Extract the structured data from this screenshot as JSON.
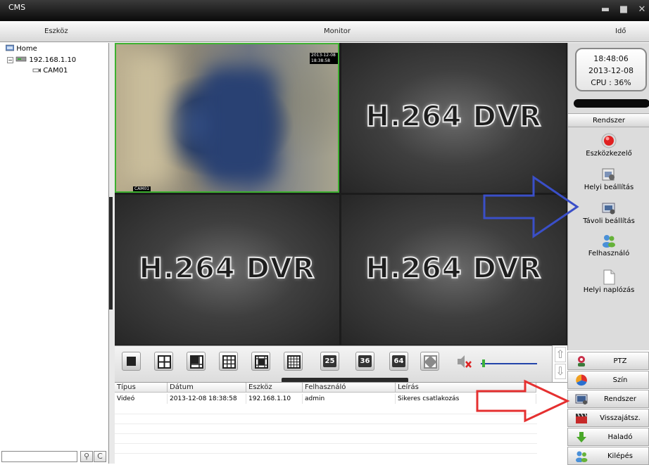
{
  "window": {
    "title": "CMS"
  },
  "headers": {
    "device": "Eszköz",
    "monitor": "Monitor",
    "time": "Idő"
  },
  "tree": {
    "root": "Home",
    "device": "192.168.1.10",
    "camera": "CAM01"
  },
  "grid": {
    "watermark": "H.264 DVR",
    "cam_timestamp": "2013-12-08 18:38:58",
    "cam_label": "CAM01"
  },
  "toolbar": {
    "btn25": "25",
    "btn36": "36",
    "btn64": "64"
  },
  "events": {
    "columns": [
      "Típus",
      "Dátum",
      "Eszköz",
      "Felhasználó",
      "Leírás"
    ],
    "rows": [
      [
        "Videó",
        "2013-12-08 18:38:58",
        "192.168.1.10",
        "admin",
        "Sikeres csatlakozás"
      ]
    ]
  },
  "clock": {
    "time": "18:48:06",
    "date": "2013-12-08",
    "cpu": "CPU : 36%"
  },
  "system": {
    "header": "Rendszer",
    "items": [
      "Eszközkezelő",
      "Helyi beállítás",
      "Távoli beállítás",
      "Felhasználó",
      "Helyi naplózás"
    ]
  },
  "nav": {
    "items": [
      "PTZ",
      "Szín",
      "Rendszer",
      "Visszajátsz.",
      "Haladó",
      "Kilépés"
    ]
  },
  "colors": {
    "annotation_blue": "#3a4fc8",
    "annotation_red": "#e53030",
    "selected_border": "#3db030"
  }
}
